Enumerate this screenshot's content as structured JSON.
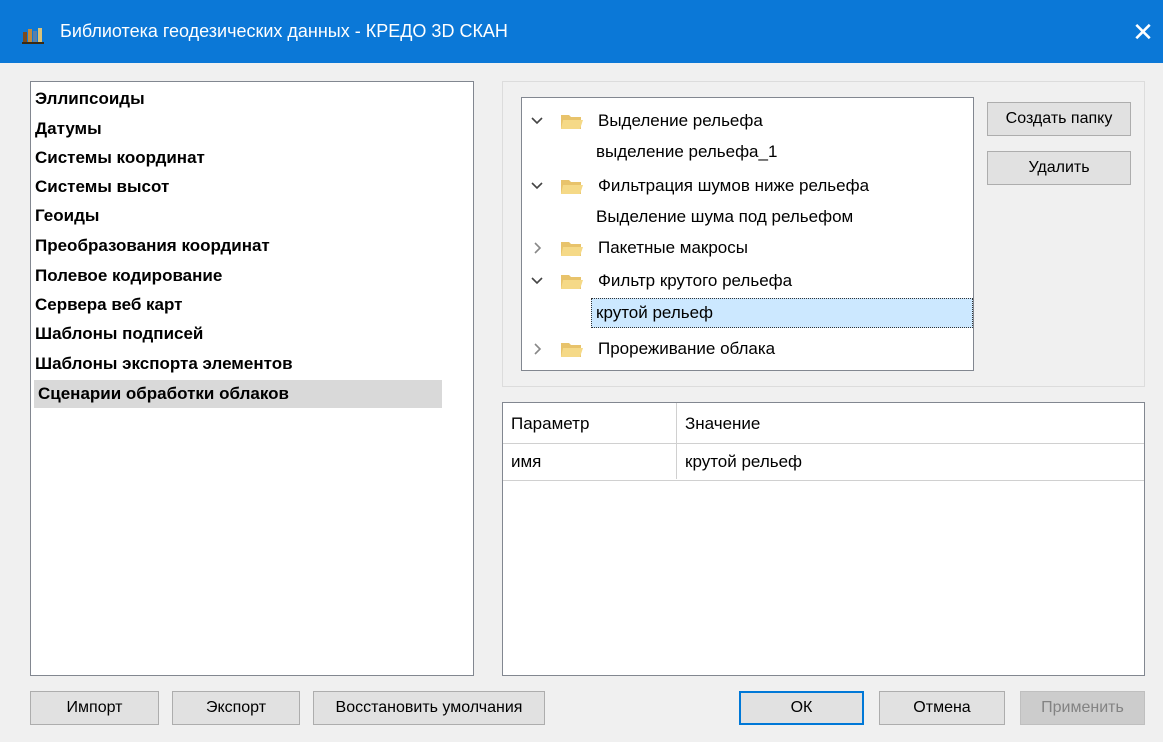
{
  "window": {
    "title": "Библиотека геодезических данных - КРЕДО 3D СКАН",
    "close_glyph": "✕",
    "titlebar_color": "#0b78d7"
  },
  "left_list": {
    "items": [
      {
        "label": "Эллипсоиды"
      },
      {
        "label": "Датумы"
      },
      {
        "label": "Системы координат"
      },
      {
        "label": "Системы высот"
      },
      {
        "label": "Геоиды"
      },
      {
        "label": "Преобразования координат"
      },
      {
        "label": "Полевое кодирование"
      },
      {
        "label": "Сервера веб карт"
      },
      {
        "label": "Шаблоны подписей"
      },
      {
        "label": "Шаблоны экспорта элементов"
      },
      {
        "label": "Сценарии обработки облаков",
        "selected": true
      }
    ]
  },
  "tree": {
    "nodes": [
      {
        "label": "Выделение рельефа",
        "type": "folder",
        "expanded": true
      },
      {
        "label": "выделение рельефа_1",
        "type": "item"
      },
      {
        "label": "Фильтрация шумов ниже рельефа",
        "type": "folder",
        "expanded": true
      },
      {
        "label": "Выделение шума под рельефом",
        "type": "item"
      },
      {
        "label": "Пакетные макросы",
        "type": "folder",
        "expanded": false
      },
      {
        "label": "Фильтр крутого рельефа",
        "type": "folder",
        "expanded": true
      },
      {
        "label": "крутой рельеф",
        "type": "item",
        "selected": true
      },
      {
        "label": "Прореживание облака",
        "type": "folder",
        "expanded": false
      }
    ],
    "selection_color": "#cce8ff"
  },
  "tree_buttons": {
    "create_folder": "Создать папку",
    "delete": "Удалить"
  },
  "properties": {
    "columns": [
      "Параметр",
      "Значение"
    ],
    "rows": [
      {
        "param": "имя",
        "value": "крутой рельеф"
      }
    ]
  },
  "footer": {
    "import": "Импорт",
    "export": "Экспорт",
    "restore_defaults": "Восстановить умолчания",
    "ok": "ОК",
    "cancel": "Отмена",
    "apply": "Применить"
  }
}
